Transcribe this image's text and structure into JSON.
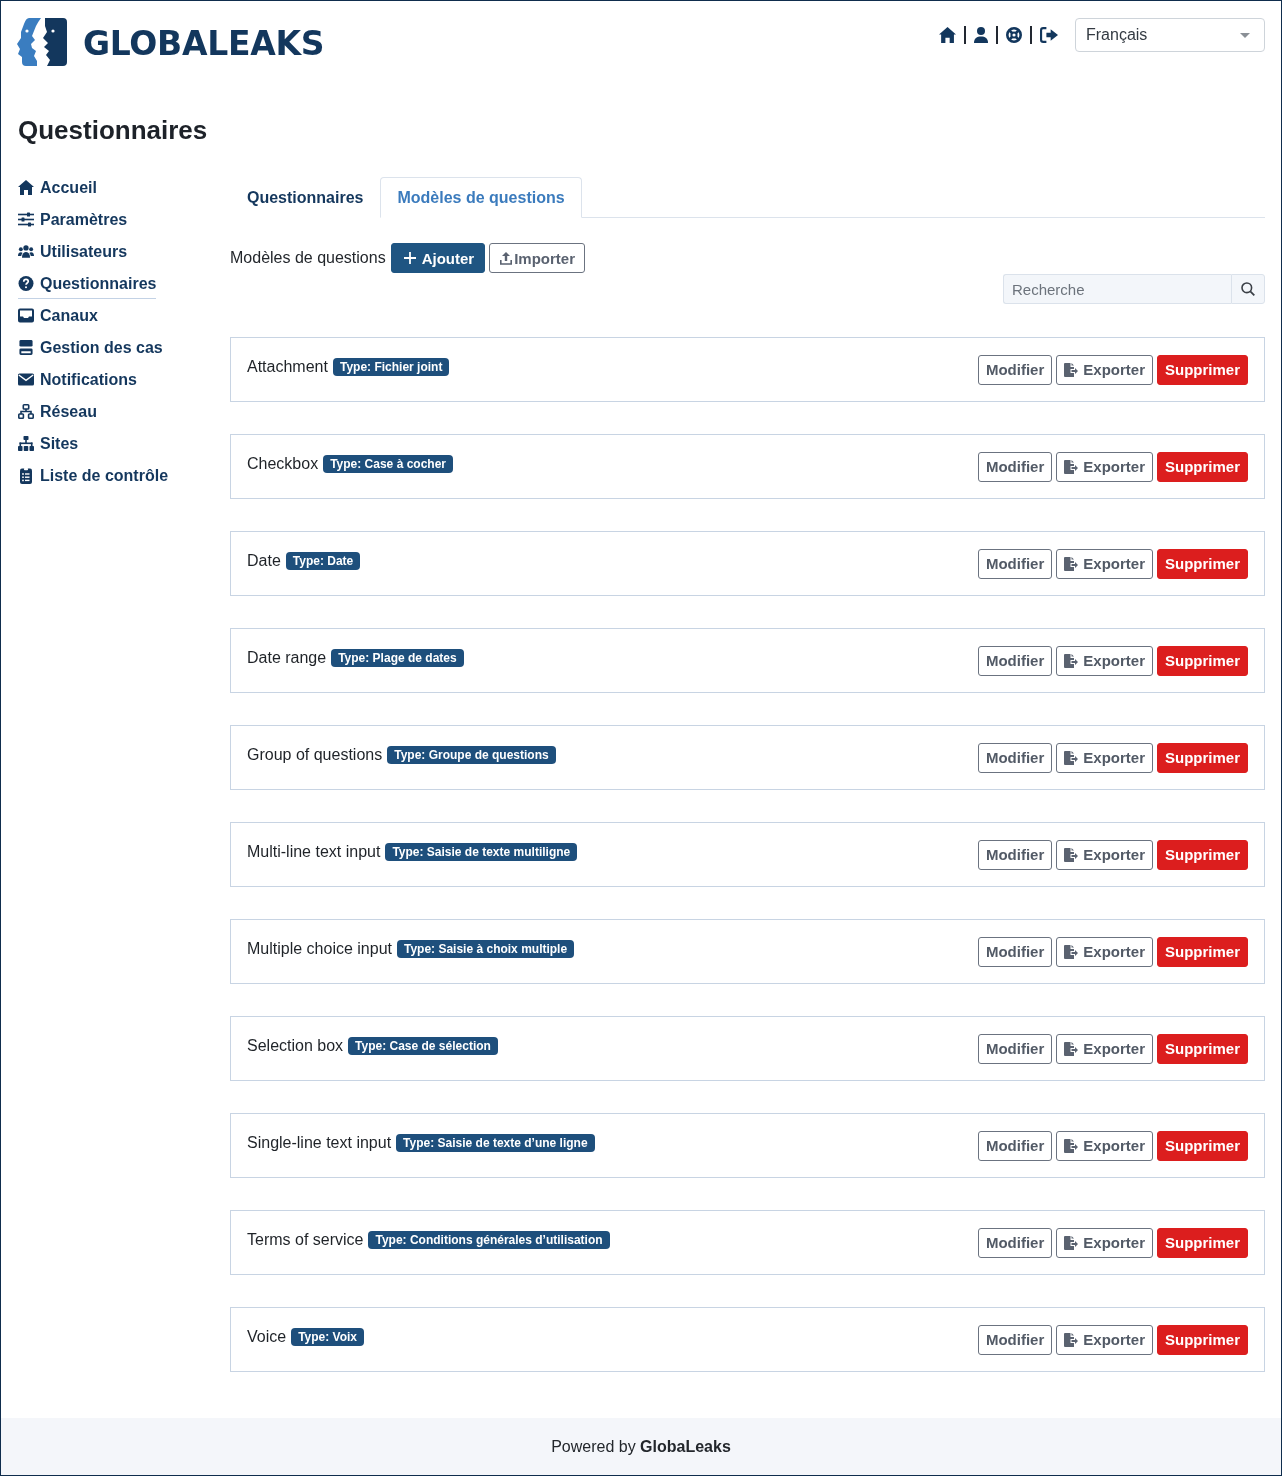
{
  "header": {
    "logo_text": "GLOBALEAKS",
    "language_select": {
      "value": "Français"
    }
  },
  "page_title": "Questionnaires",
  "sidebar": {
    "items": [
      {
        "label": "Accueil",
        "selected": false
      },
      {
        "label": "Paramètres",
        "selected": false
      },
      {
        "label": "Utilisateurs",
        "selected": false
      },
      {
        "label": "Questionnaires",
        "selected": true
      },
      {
        "label": "Canaux",
        "selected": false
      },
      {
        "label": "Gestion des cas",
        "selected": false
      },
      {
        "label": "Notifications",
        "selected": false
      },
      {
        "label": "Réseau",
        "selected": false
      },
      {
        "label": "Sites",
        "selected": false
      },
      {
        "label": "Liste de contrôle",
        "selected": false
      }
    ]
  },
  "tabs": [
    {
      "label": "Questionnaires",
      "selected": false
    },
    {
      "label": "Modèles de questions",
      "selected": true
    }
  ],
  "toolbar": {
    "label": "Modèles de questions",
    "buttons": [
      {
        "label": "Ajouter",
        "kind": "primary"
      },
      {
        "label": "Importer",
        "kind": "outline"
      }
    ]
  },
  "search": {
    "placeholder": "Recherche"
  },
  "templates": [
    {
      "name": "Attachment",
      "type_badge": "Type: Fichier joint",
      "buttons": [
        {
          "label": "Modifier",
          "kind": "edit"
        },
        {
          "label": "Exporter",
          "kind": "export"
        },
        {
          "label": "Supprimer",
          "kind": "delete"
        }
      ]
    },
    {
      "name": "Checkbox",
      "type_badge": "Type: Case à cocher",
      "buttons": [
        {
          "label": "Modifier",
          "kind": "edit"
        },
        {
          "label": "Exporter",
          "kind": "export"
        },
        {
          "label": "Supprimer",
          "kind": "delete"
        }
      ]
    },
    {
      "name": "Date",
      "type_badge": "Type: Date",
      "buttons": [
        {
          "label": "Modifier",
          "kind": "edit"
        },
        {
          "label": "Exporter",
          "kind": "export"
        },
        {
          "label": "Supprimer",
          "kind": "delete"
        }
      ]
    },
    {
      "name": "Date range",
      "type_badge": "Type: Plage de dates",
      "buttons": [
        {
          "label": "Modifier",
          "kind": "edit"
        },
        {
          "label": "Exporter",
          "kind": "export"
        },
        {
          "label": "Supprimer",
          "kind": "delete"
        }
      ]
    },
    {
      "name": "Group of questions",
      "type_badge": "Type: Groupe de questions",
      "buttons": [
        {
          "label": "Modifier",
          "kind": "edit"
        },
        {
          "label": "Exporter",
          "kind": "export"
        },
        {
          "label": "Supprimer",
          "kind": "delete"
        }
      ]
    },
    {
      "name": "Multi-line text input",
      "type_badge": "Type: Saisie de texte multiligne",
      "buttons": [
        {
          "label": "Modifier",
          "kind": "edit"
        },
        {
          "label": "Exporter",
          "kind": "export"
        },
        {
          "label": "Supprimer",
          "kind": "delete"
        }
      ]
    },
    {
      "name": "Multiple choice input",
      "type_badge": "Type: Saisie à choix multiple",
      "buttons": [
        {
          "label": "Modifier",
          "kind": "edit"
        },
        {
          "label": "Exporter",
          "kind": "export"
        },
        {
          "label": "Supprimer",
          "kind": "delete"
        }
      ]
    },
    {
      "name": "Selection box",
      "type_badge": "Type: Case de sélection",
      "buttons": [
        {
          "label": "Modifier",
          "kind": "edit"
        },
        {
          "label": "Exporter",
          "kind": "export"
        },
        {
          "label": "Supprimer",
          "kind": "delete"
        }
      ]
    },
    {
      "name": "Single-line text input",
      "type_badge": "Type: Saisie de texte d’une ligne",
      "buttons": [
        {
          "label": "Modifier",
          "kind": "edit"
        },
        {
          "label": "Exporter",
          "kind": "export"
        },
        {
          "label": "Supprimer",
          "kind": "delete"
        }
      ]
    },
    {
      "name": "Terms of service",
      "type_badge": "Type: Conditions générales d’utilisation",
      "buttons": [
        {
          "label": "Modifier",
          "kind": "edit"
        },
        {
          "label": "Exporter",
          "kind": "export"
        },
        {
          "label": "Supprimer",
          "kind": "delete"
        }
      ]
    },
    {
      "name": "Voice",
      "type_badge": "Type: Voix",
      "buttons": [
        {
          "label": "Modifier",
          "kind": "edit"
        },
        {
          "label": "Exporter",
          "kind": "export"
        },
        {
          "label": "Supprimer",
          "kind": "delete"
        }
      ]
    }
  ],
  "footer": {
    "text": "Powered by **GlobaLeaks**"
  }
}
